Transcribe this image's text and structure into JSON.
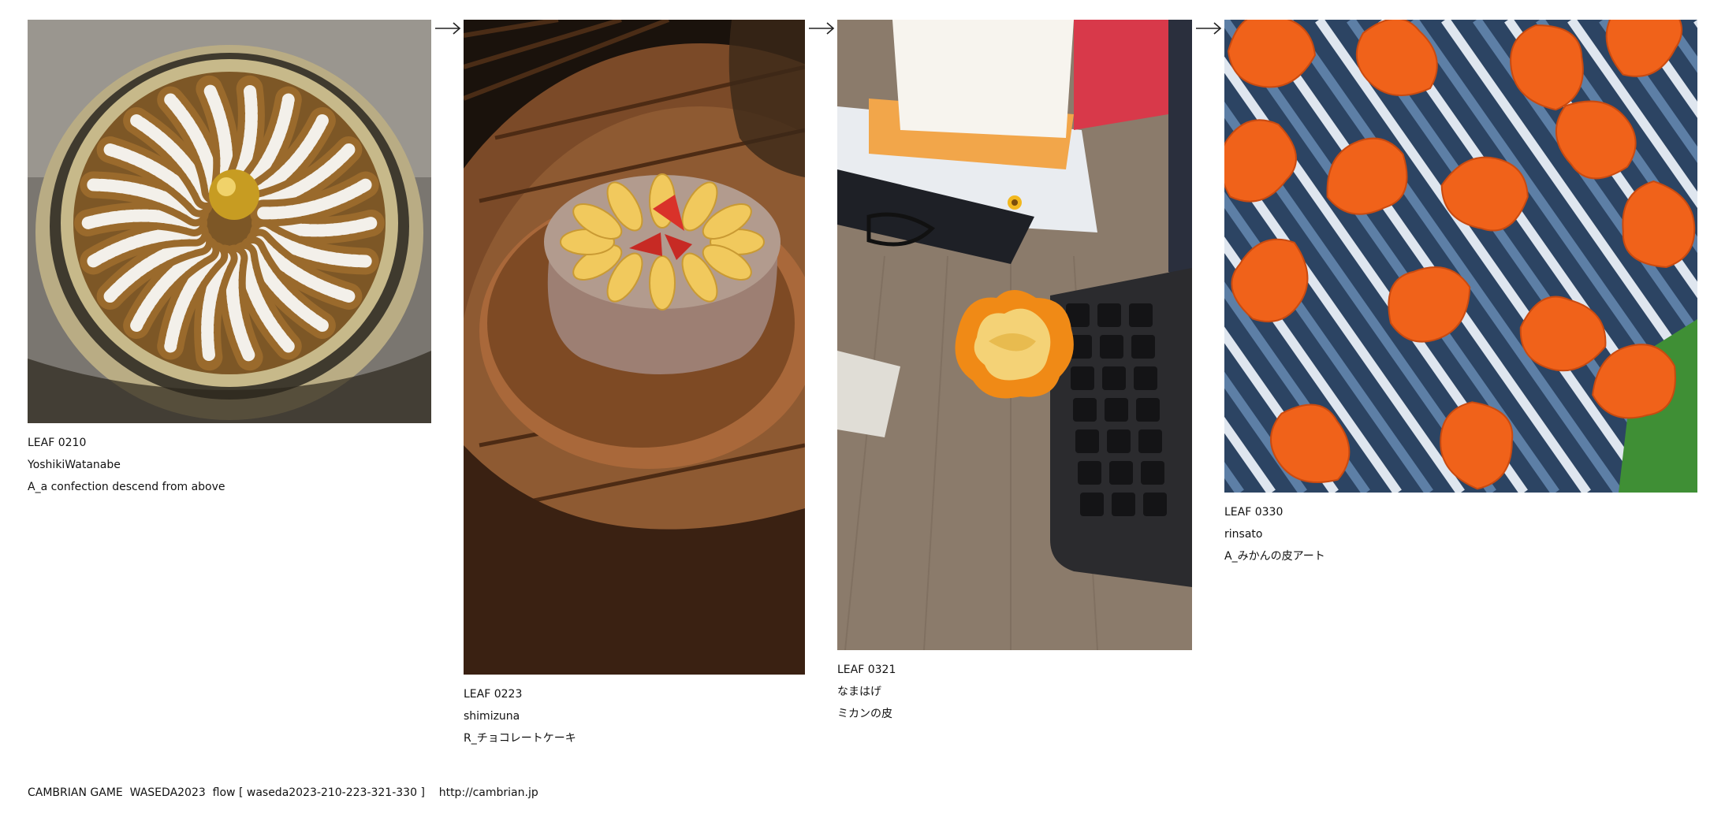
{
  "leaves": [
    {
      "id": "LEAF 0210",
      "author": "YoshikiWatanabe",
      "title": "A_a confection descend from above",
      "image": "spiral-pastry-in-silver-dish"
    },
    {
      "id": "LEAF 0223",
      "author": "shimizuna",
      "title": "R_チョコレートケーキ",
      "image": "chocolate-cake-with-orange-slices-on-wooden-table"
    },
    {
      "id": "LEAF 0321",
      "author": "なまはげ",
      "title": "ミカンの皮",
      "image": "peeled-mandarin-on-desk-beside-keyboard"
    },
    {
      "id": "LEAF 0330",
      "author": "rinsato",
      "title": "A_みかんの皮アート",
      "image": "orange-peel-art-on-striped-cloth"
    }
  ],
  "flow_arrow_icon": "right-arrow-icon",
  "footer": {
    "text": "CAMBRIAN GAME  WASEDA2023  flow [ waseda2023-210-223-321-330 ]    http://cambrian.jp"
  }
}
